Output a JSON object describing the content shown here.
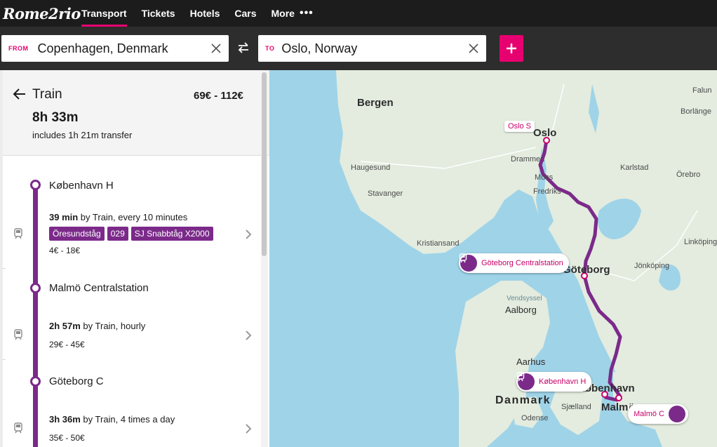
{
  "brand": {
    "logo": "Rome2rio"
  },
  "nav": {
    "tabs": [
      {
        "label": "Transport",
        "active": true
      },
      {
        "label": "Tickets"
      },
      {
        "label": "Hotels"
      },
      {
        "label": "Cars"
      },
      {
        "label": "More"
      }
    ],
    "more_icon": "ellipsis-icon"
  },
  "search": {
    "from_tag": "FROM",
    "from_value": "Copenhagen, Denmark",
    "to_tag": "TO",
    "to_value": "Oslo, Norway",
    "add_label": "+"
  },
  "route": {
    "mode": "Train",
    "price": "69€ - 112€",
    "duration": "8h 33m",
    "transfer": "includes 1h 21m transfer",
    "stops": [
      {
        "name": "København H"
      },
      {
        "name": "Malmö Centralstation"
      },
      {
        "name": "Göteborg C"
      }
    ],
    "segments": [
      {
        "time": "39 min",
        "detail": " by Train, every 10 minutes",
        "badges": [
          "Öresundståg",
          "029",
          "SJ Snabbtåg X2000"
        ],
        "price": "4€ - 18€"
      },
      {
        "time": "2h 57m",
        "detail": " by Train, hourly",
        "price": "29€ - 45€"
      },
      {
        "time": "3h 36m",
        "detail": " by Train, 4 times a day",
        "price": "35€ - 50€"
      }
    ]
  },
  "map": {
    "labels": {
      "bergen": "Bergen",
      "oslo": "Oslo",
      "drammen": "Drammen",
      "haugesund": "Haugesund",
      "moss": "Moss",
      "fredrikstad": "Fredriks",
      "stavanger": "Stavanger",
      "kristiansand": "Kristiansand",
      "karlstad": "Karlstad",
      "orebro": "Örebro",
      "falun": "Falun",
      "borlange": "Borlänge",
      "linkoping": "Linköping",
      "jonkoping": "Jönköping",
      "goteborg": "Göteborg",
      "vendsyssel": "Vendsyssel",
      "aalborg": "Aalborg",
      "aarhus": "Aarhus",
      "danmark": "Danmark",
      "kobenhavn": "København",
      "malmo": "Malmö",
      "sjaelland": "Sjælland",
      "odense": "Odense"
    },
    "pins": {
      "oslo": "Oslo S",
      "goteborg": "Göteborg Centralstation",
      "kobenhavn": "København H",
      "malmo": "Malmö C"
    },
    "colors": {
      "route": "#7b2a8a",
      "accent": "#e7006f",
      "water": "#9fd3e8",
      "land": "#e3ecdf"
    }
  }
}
